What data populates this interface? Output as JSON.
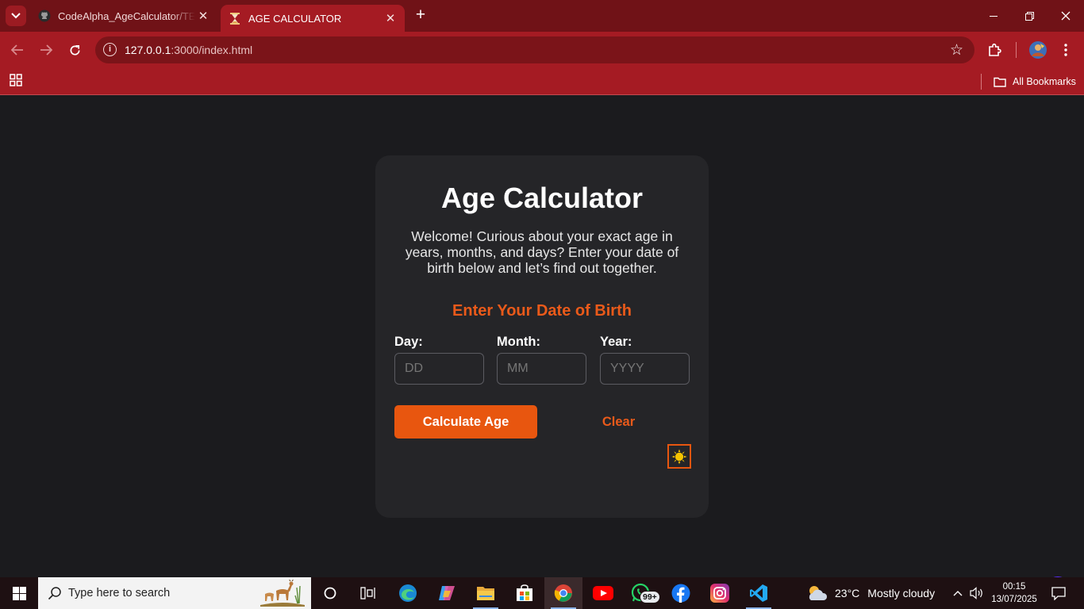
{
  "browser": {
    "tabs": [
      {
        "title": "CodeAlpha_AgeCalculator/TEST",
        "favicon": "github-icon"
      },
      {
        "title": "AGE CALCULATOR",
        "favicon": "hourglass-icon",
        "active": true
      }
    ],
    "url_host": "127.0.0.1",
    "url_path": ":3000/index.html",
    "bookmarks_label": "All Bookmarks",
    "colors": {
      "tabbar": "#701217",
      "toolbar": "#a51b23"
    }
  },
  "app": {
    "title": "Age Calculator",
    "intro": "Welcome! Curious about your exact age in years, months, and days? Enter your date of birth below and let’s find out together.",
    "section_title": "Enter Your Date of Birth",
    "fields": {
      "day": {
        "label": "Day:",
        "placeholder": "DD"
      },
      "month": {
        "label": "Month:",
        "placeholder": "MM"
      },
      "year": {
        "label": "Year:",
        "placeholder": "YYYY"
      }
    },
    "calculate_label": "Calculate Age",
    "clear_label": "Clear",
    "theme_toggle_icon": "sun-icon",
    "colors": {
      "accent": "#e8560f",
      "card": "#252528",
      "background": "#1b1b1e"
    }
  },
  "taskbar": {
    "search_placeholder": "Type here to search",
    "whatsapp_badge": "99+",
    "weather": {
      "temp": "23°C",
      "condition": "Mostly cloudy"
    },
    "time": "00:15",
    "date": "13/07/2025"
  }
}
